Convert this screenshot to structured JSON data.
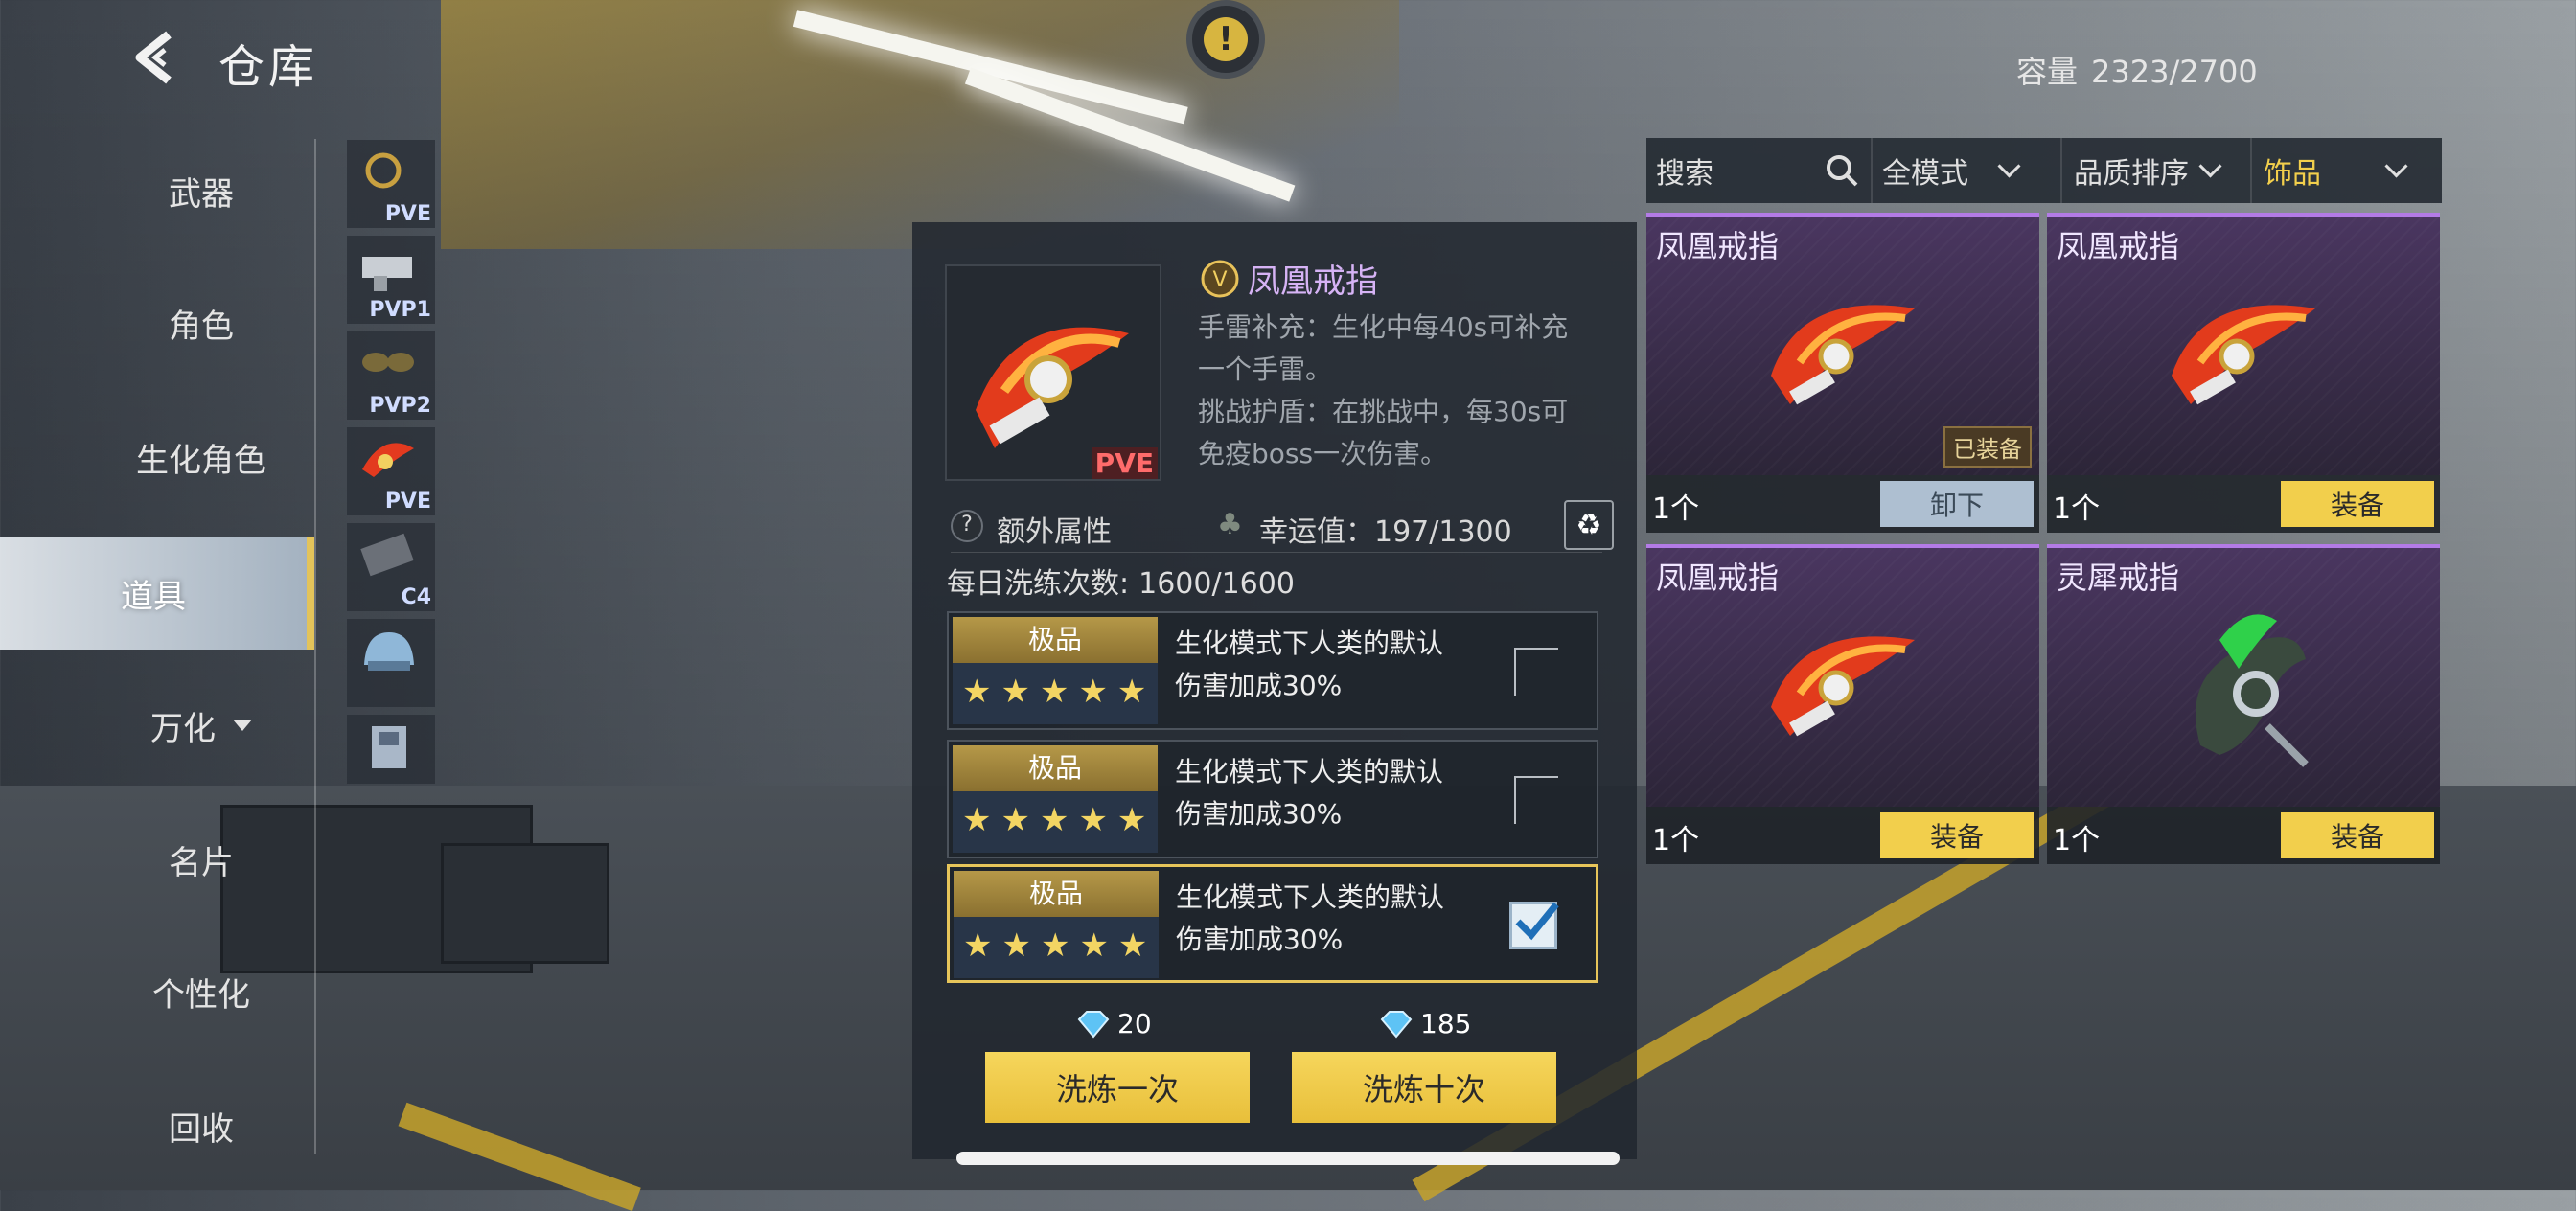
{
  "header": {
    "title": "仓库",
    "capacity_label": "容量",
    "capacity_value": "2323/2700"
  },
  "left_nav": {
    "items": [
      {
        "label": "武器"
      },
      {
        "label": "角色"
      },
      {
        "label": "生化角色"
      },
      {
        "label": "道具"
      },
      {
        "label": "万化"
      },
      {
        "label": "名片"
      },
      {
        "label": "个性化"
      },
      {
        "label": "回收"
      }
    ],
    "active": "道具"
  },
  "sub_tabs": [
    {
      "tag": "PVE",
      "icon": "headset-ring-icon"
    },
    {
      "tag": "PVP1",
      "icon": "gun-part-icon"
    },
    {
      "tag": "PVP2",
      "icon": "goggles-icon"
    },
    {
      "tag": "PVE",
      "icon": "phoenix-ring-icon"
    },
    {
      "tag": "C4",
      "icon": "c4-icon"
    },
    {
      "tag": "",
      "icon": "helmet-icon"
    },
    {
      "tag": "",
      "icon": "armor-icon"
    }
  ],
  "detail": {
    "item_name": "凤凰戒指",
    "thumb_tag": "PVE",
    "description": [
      "手雷补充：生化中每40s可补充",
      "一个手雷。",
      "挑战护盾：在挑战中，每30s可",
      "免疫boss一次伤害。"
    ],
    "extra_label": "额外属性",
    "luck_label": "幸运值：",
    "luck_value": "197/1300",
    "daily_label": "每日洗练次数:",
    "daily_value": "1600/1600",
    "attributes": [
      {
        "grade": "极品",
        "stars": "★★★★★",
        "line1": "生化模式下人类的默认",
        "line2": "伤害加成30%",
        "selected": false
      },
      {
        "grade": "极品",
        "stars": "★★★★★",
        "line1": "生化模式下人类的默认",
        "line2": "伤害加成30%",
        "selected": false
      },
      {
        "grade": "极品",
        "stars": "★★★★★",
        "line1": "生化模式下人类的默认",
        "line2": "伤害加成30%",
        "selected": true
      }
    ],
    "cost_once": "20",
    "cost_ten": "185",
    "btn_once": "洗炼一次",
    "btn_ten": "洗炼十次"
  },
  "filters": {
    "search_placeholder": "搜索",
    "mode": "全模式",
    "sort": "品质排序",
    "category": "饰品"
  },
  "inventory": [
    {
      "name": "凤凰戒指",
      "count": "1个",
      "action": "卸下",
      "equipped_tag": "已装备",
      "kind": "phoenix"
    },
    {
      "name": "凤凰戒指",
      "count": "1个",
      "action": "装备",
      "equipped_tag": "",
      "kind": "phoenix"
    },
    {
      "name": "凤凰戒指",
      "count": "1个",
      "action": "装备",
      "equipped_tag": "",
      "kind": "phoenix"
    },
    {
      "name": "灵犀戒指",
      "count": "1个",
      "action": "装备",
      "equipped_tag": "",
      "kind": "lingxi"
    }
  ],
  "colors": {
    "accent_gold": "#f2cf4c",
    "rarity_purple": "#b37be6",
    "unequip_grey": "#aebfd1"
  }
}
